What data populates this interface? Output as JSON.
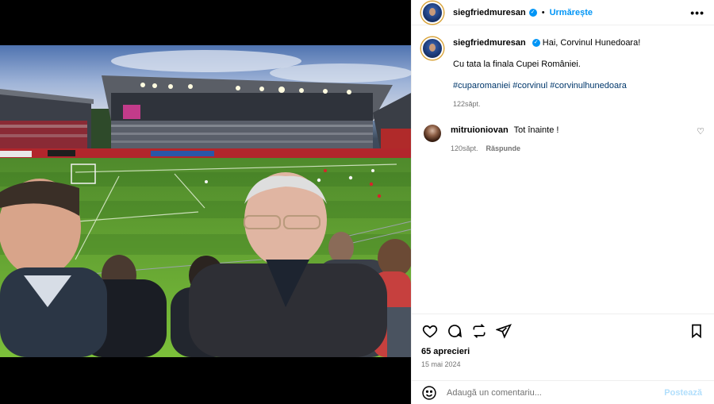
{
  "post": {
    "username": "siegfriedmuresan",
    "follow_label": "Urmărește",
    "more_label": "•••"
  },
  "caption": {
    "username": "siegfriedmuresan",
    "text_line1": "Hai, Corvinul Hunedoara!",
    "text_line2": "Cu tata la finala Cupei României.",
    "hashtags": "#cuparomaniei #corvinul #corvinulhunedoara",
    "time": "122săpt."
  },
  "comments": [
    {
      "username": "mitruioniovan",
      "text": "Tot înainte !",
      "time": "120săpt.",
      "reply_label": "Răspunde"
    }
  ],
  "likes_text": "65 aprecieri",
  "date_text": "15 mai 2024",
  "add_comment": {
    "placeholder": "Adaugă un comentariu...",
    "post_label": "Postează"
  },
  "icons": {
    "like": "heart-icon",
    "comment": "comment-icon",
    "share": "repost-icon",
    "send": "send-icon",
    "save": "bookmark-icon",
    "emoji": "emoji-icon"
  },
  "colors": {
    "accent": "#0095f6",
    "link": "#00376b",
    "muted": "#737373"
  }
}
